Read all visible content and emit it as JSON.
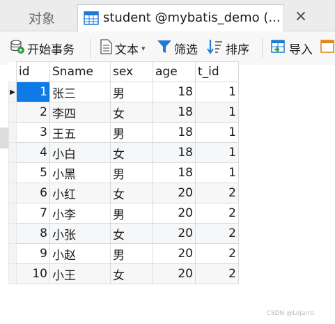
{
  "tabs": {
    "objects_label": "对象",
    "active_label": "student @mybatis_demo (...",
    "close_glyph": "×"
  },
  "toolbar": {
    "begin_transaction": "开始事务",
    "text": "文本",
    "filter": "筛选",
    "sort": "排序",
    "import": "导入"
  },
  "table": {
    "columns": [
      "id",
      "Sname",
      "sex",
      "age",
      "t_id"
    ],
    "rows": [
      [
        "1",
        "张三",
        "男",
        "18",
        "1"
      ],
      [
        "2",
        "李四",
        "女",
        "18",
        "1"
      ],
      [
        "3",
        "王五",
        "男",
        "18",
        "1"
      ],
      [
        "4",
        "小白",
        "女",
        "18",
        "1"
      ],
      [
        "5",
        "小黑",
        "男",
        "18",
        "1"
      ],
      [
        "6",
        "小红",
        "女",
        "20",
        "2"
      ],
      [
        "7",
        "小李",
        "男",
        "20",
        "2"
      ],
      [
        "8",
        "小张",
        "女",
        "20",
        "2"
      ],
      [
        "9",
        "小赵",
        "男",
        "20",
        "2"
      ],
      [
        "10",
        "小王",
        "女",
        "20",
        "2"
      ]
    ],
    "selected_row": 0
  },
  "watermark": "CSDN @Lojarro",
  "colors": {
    "selection": "#0f7ae5",
    "accent_blue": "#1f7ad6"
  }
}
